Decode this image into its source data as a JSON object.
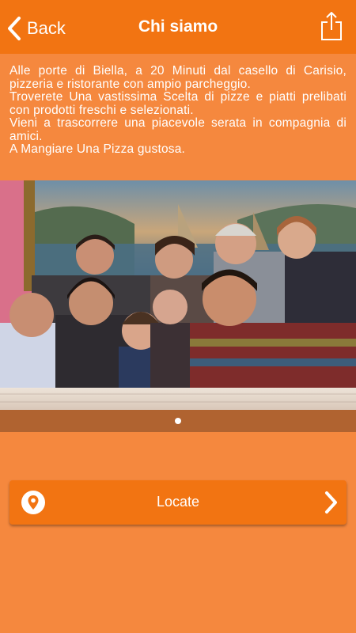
{
  "navbar": {
    "back_label": "Back",
    "title": "Chi siamo",
    "back_icon": "chevron-left-icon",
    "share_icon": "share-icon"
  },
  "intro": {
    "paragraphs": [
      "Alle porte di Biella, a 20 Minuti dal casello di Carisio, pizzeria e ristorante con ampio parcheggio.",
      "Troverete Una vastissima Scelta di pizze e piatti prelibati con prodotti freschi e selezionati.",
      "Vieni a trascorrere una piacevole serata in compagnia di amici.",
      "A Mangiare Una Pizza gustosa."
    ]
  },
  "gallery": {
    "current_page": 1,
    "total_pages": 1
  },
  "locate": {
    "label": "Locate",
    "icon": "map-pin-icon",
    "chevron_icon": "chevron-right-icon"
  },
  "colors": {
    "navbar": "#F27412",
    "background": "#F5883E",
    "pager_bar": "#B06330",
    "text": "#FFFFFF"
  }
}
